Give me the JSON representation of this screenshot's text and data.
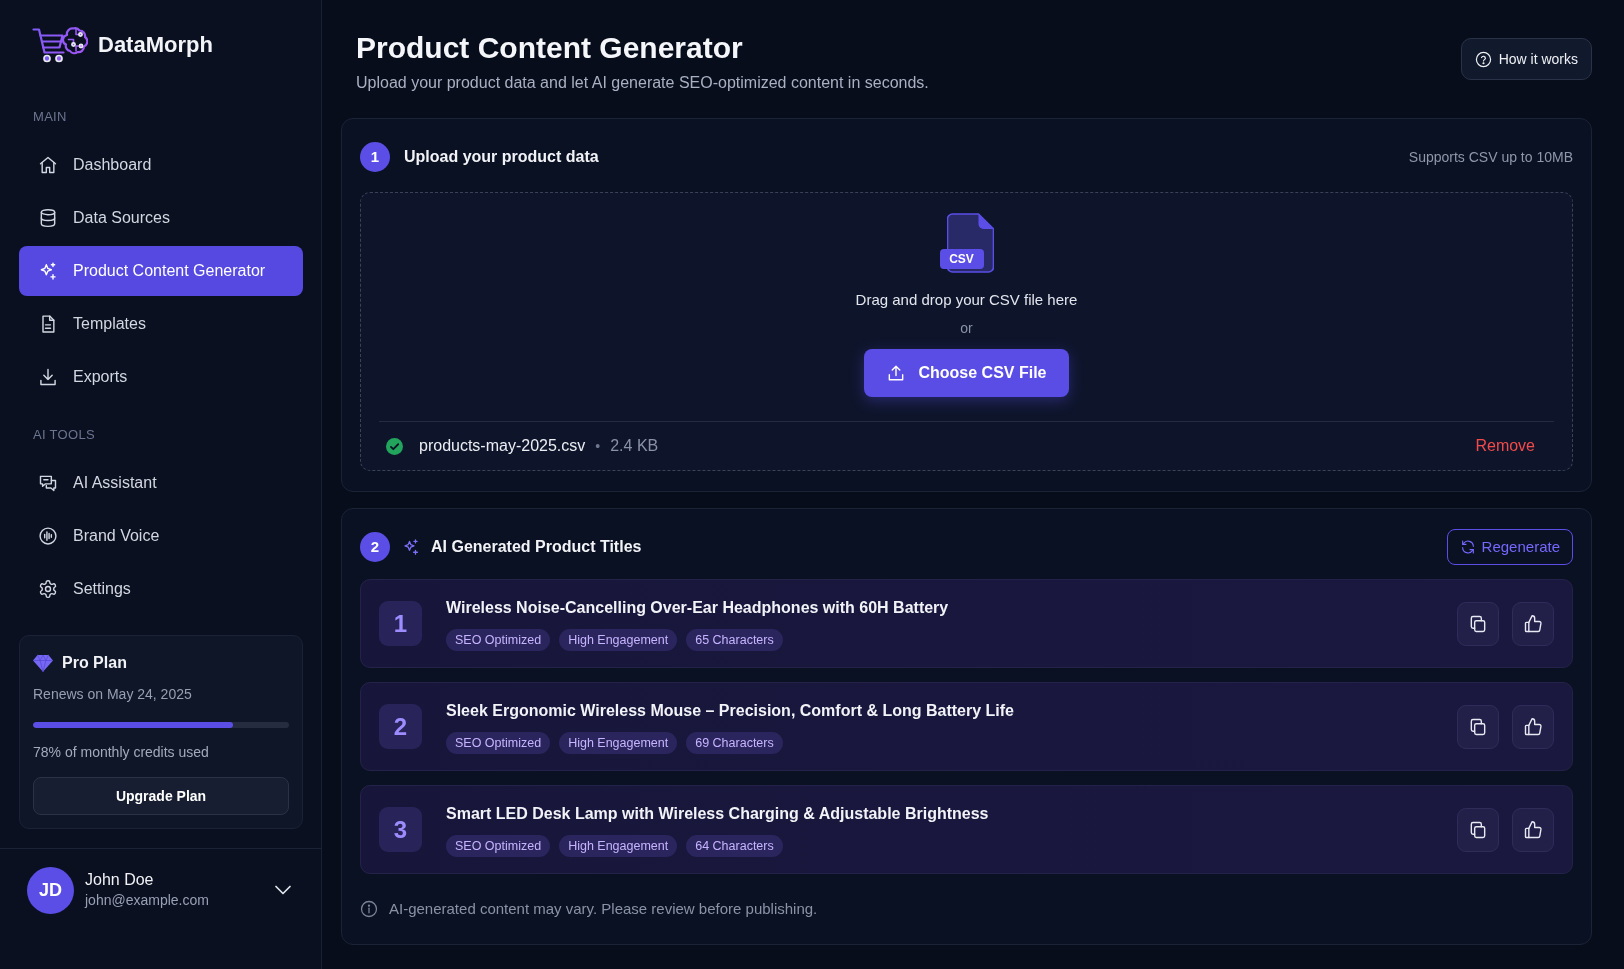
{
  "sidebar": {
    "brand": "DataMorph",
    "sections": [
      {
        "label": "MAIN",
        "items": [
          {
            "label": "Dashboard",
            "selected": false
          },
          {
            "label": "Data Sources",
            "selected": false
          },
          {
            "label": "Product Content Generator",
            "selected": true
          },
          {
            "label": "Templates",
            "selected": false
          },
          {
            "label": "Exports",
            "selected": false
          }
        ]
      },
      {
        "label": "AI TOOLS",
        "items": [
          {
            "label": "AI Assistant",
            "selected": false
          },
          {
            "label": "Brand Voice",
            "selected": false
          },
          {
            "label": "Settings",
            "selected": false
          }
        ]
      }
    ],
    "plan": {
      "name": "Pro Plan",
      "renewal": "Renews on May 24, 2025",
      "level": 0.78,
      "usage": "78% of monthly credits used",
      "button": "Upgrade Plan"
    },
    "user": {
      "initials": "JD",
      "name": "John Doe",
      "email": "john@example.com"
    }
  },
  "header": {
    "title": "Product Content Generator",
    "subtitle": "Upload your product data and let AI generate SEO-optimized content in seconds.",
    "help_button": "How it works"
  },
  "upload": {
    "step": "1",
    "title": "Upload your product data",
    "note": "Supports CSV up to 10MB",
    "dropzone": {
      "file_badge": "CSV",
      "prompt": "Drag and drop your CSV file here",
      "separator": "or",
      "button": "Choose CSV File"
    },
    "file": {
      "name": "products-may-2025.csv",
      "separator": "•",
      "size": "2.4 KB",
      "action": "Remove"
    }
  },
  "titles": {
    "step": "2",
    "title": "AI Generated Product Titles",
    "button": "Regenerate",
    "items": [
      {
        "number": "1",
        "text": "Wireless Noise-Cancelling Over-Ear Headphones with 60H Battery",
        "tags": [
          "SEO Optimized",
          "High Engagement",
          "65 Characters"
        ]
      },
      {
        "number": "2",
        "text": "Sleek Ergonomic Wireless Mouse – Precision, Comfort & Long Battery Life",
        "tags": [
          "SEO Optimized",
          "High Engagement",
          "69 Characters"
        ]
      },
      {
        "number": "3",
        "text": "Smart LED Desk Lamp with Wireless Charging & Adjustable Brightness",
        "tags": [
          "SEO Optimized",
          "High Engagement",
          "64 Characters"
        ]
      }
    ],
    "note": "AI-generated content may vary. Please review before publishing."
  }
}
